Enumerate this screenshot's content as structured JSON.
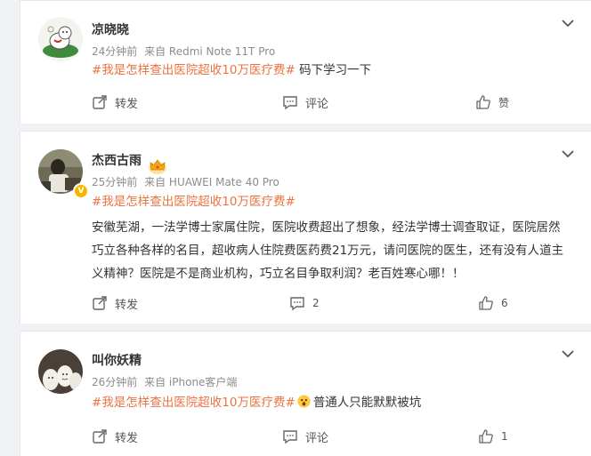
{
  "comments": [
    {
      "username": "凉晓晓",
      "time": "24分钟前",
      "source": "来自 Redmi Note 11T Pro",
      "hashtag": "#我是怎样查出医院超收10万医疗费#",
      "text": " 码下学习一下",
      "repost_label": "转发",
      "comment_label": "评论",
      "like_label": "赞",
      "avatar_icon": "cartoon-avatar-icon"
    },
    {
      "username": "杰西古雨",
      "time": "25分钟前",
      "source": "来自 HUAWEI Mate 40 Pro",
      "hashtag": "#我是怎样查出医院超收10万医疗费#",
      "text": "安徽芜湖，一法学博士家属住院，医院收费超出了想象，经法学博士调查取证，医院居然巧立各种各样的名目，超收病人住院费医药费21万元，请问医院的医生，还有没有人道主义精神？医院是不是商业机构，巧立名目争取利润？老百姓寒心哪！！",
      "repost_label": "转发",
      "comment_count": "2",
      "like_count": "6",
      "avatar_icon": "photo-avatar-icon",
      "badge_icon": "crown-badge-icon",
      "verified_icon": "verified-v-icon"
    },
    {
      "username": "叫你妖精",
      "time": "26分钟前",
      "source": "来自 iPhone客户端",
      "hashtag": "#我是怎样查出医院超收10万医疗费#",
      "text": "普通人只能默默被坑",
      "repost_label": "转发",
      "comment_label": "评论",
      "like_count": "1",
      "avatar_icon": "eggs-avatar-icon",
      "emoji_icon": "shocked-face-emoji-icon"
    }
  ],
  "colors": {
    "hashtag": "#eb7340",
    "meta": "#8c8c8c",
    "background": "#f0f1f4"
  }
}
